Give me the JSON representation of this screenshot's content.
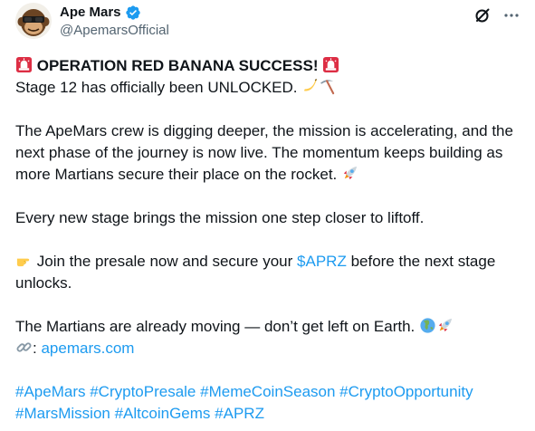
{
  "author": {
    "display_name": "Ape Mars",
    "handle": "@ApemarsOfficial"
  },
  "icons": {
    "avatar": "ape-avatar",
    "verified": "verified-badge-icon",
    "grok": "grok-icon",
    "more": "more-icon",
    "siren": "siren-emoji",
    "banana": "banana-emoji",
    "pick": "pick-emoji",
    "rocket": "rocket-emoji",
    "pointing_hand": "pointing-hand-emoji",
    "globe": "globe-emoji",
    "link": "link-emoji"
  },
  "colors": {
    "link": "#1d9bf0",
    "verified": "#1d9bf0",
    "text": "#0f1419",
    "secondary": "#536471"
  },
  "post": {
    "headline": "OPERATION RED BANANA SUCCESS!",
    "stage_line": "Stage 12 has officially been UNLOCKED.",
    "para1_line1": "The ApeMars crew is digging deeper, the mission is accelerating, and the",
    "para1_line2": "next phase of the journey is now live. The momentum keeps building as",
    "para1_line3": "more Martians secure their place on the rocket.",
    "para2": "Every new stage brings the mission one step closer to liftoff.",
    "para3_line1_pre": "Join the presale now and secure your",
    "para3_cashtag": "$APRZ",
    "para3_line1_post": "before the next stage",
    "para3_line2": "unlocks.",
    "para4": "The Martians are already moving — don’t get left on Earth.",
    "link_prefix": ":",
    "link_text": "apemars.com",
    "hashtags_line1": [
      "#ApeMars",
      "#CryptoPresale",
      "#MemeCoinSeason",
      "#CryptoOpportunity"
    ],
    "hashtags_line2": [
      "#MarsMission",
      "#AltcoinGems",
      "#APRZ"
    ]
  }
}
